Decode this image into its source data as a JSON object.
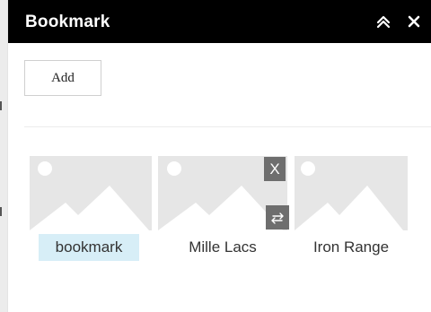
{
  "panel": {
    "title": "Bookmark",
    "add_label": "Add"
  },
  "header_icons": {
    "collapse": "double-chevron-up-icon",
    "close": "close-icon"
  },
  "bookmarks": [
    {
      "label": "bookmark",
      "editing": true
    },
    {
      "label": "Mille Lacs",
      "editing": false
    },
    {
      "label": "Iron Range",
      "editing": false
    }
  ],
  "card_actions": {
    "delete_label": "X",
    "reorder_icon": "swap-arrows-icon"
  },
  "colors": {
    "header_bg": "#000000",
    "thumbnail_bg": "#e6e6e6",
    "editing_highlight": "#d7eef7",
    "action_button_bg": "#6e6e6e"
  }
}
